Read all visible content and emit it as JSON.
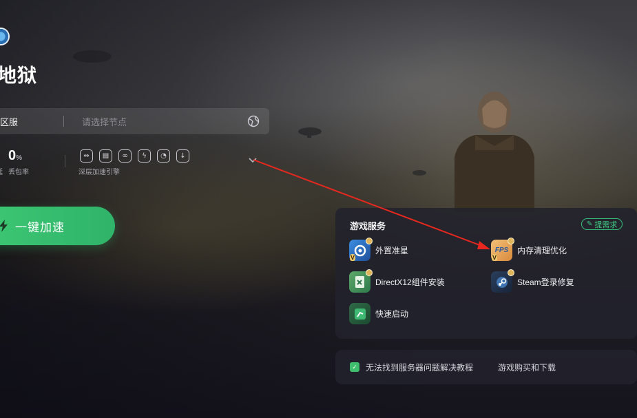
{
  "game": {
    "title": "地狱"
  },
  "server": {
    "region": "区服",
    "node_placeholder": "请选择节点"
  },
  "stats": {
    "loss_value": "0",
    "loss_unit": "%",
    "loss_label": "丢包率",
    "edge_label": "延",
    "engine_label": "深层加速引擎"
  },
  "boost": {
    "label": "一键加速"
  },
  "services": {
    "title": "游戏服务",
    "request_button": "提需求",
    "items": [
      {
        "label": "外置准星",
        "icon": "crosshair-icon"
      },
      {
        "label": "内存清理优化",
        "icon": "fps-icon"
      },
      {
        "label": "DirectX12组件安装",
        "icon": "directx-icon"
      },
      {
        "label": "Steam登录修复",
        "icon": "steam-icon"
      },
      {
        "label": "快速启动",
        "icon": "quick-launch-icon"
      }
    ]
  },
  "bottom": {
    "link1": "无法找到服务器问题解决教程",
    "link2": "游戏购买和下载"
  },
  "colors": {
    "accent_green": "#3ec973",
    "annotation_red": "#e8281e"
  }
}
